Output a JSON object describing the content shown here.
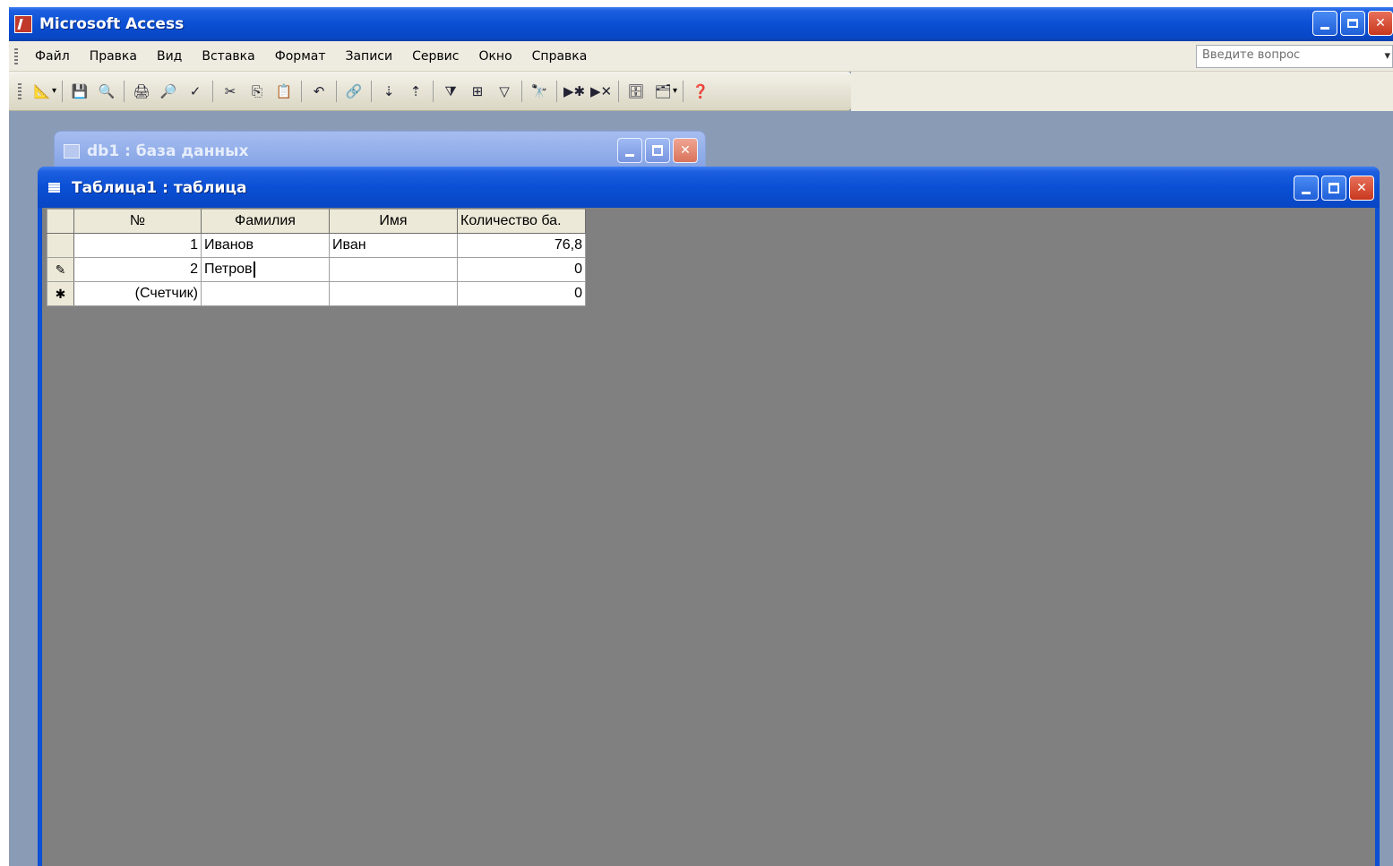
{
  "app": {
    "title": "Microsoft Access"
  },
  "menu": {
    "items": [
      "Файл",
      "Правка",
      "Вид",
      "Вставка",
      "Формат",
      "Записи",
      "Сервис",
      "Окно",
      "Справка"
    ],
    "ask_placeholder": "Введите вопрос"
  },
  "toolbar": {
    "icons": [
      "design-view-icon",
      "save-icon",
      "search-icon",
      "print-icon",
      "print-preview-icon",
      "spelling-icon",
      "cut-icon",
      "copy-icon",
      "paste-icon",
      "undo-icon",
      "hyperlink-icon",
      "sort-ascending-icon",
      "sort-descending-icon",
      "filter-by-selection-icon",
      "filter-by-form-icon",
      "apply-filter-icon",
      "find-icon",
      "new-record-icon",
      "delete-record-icon",
      "database-window-icon",
      "new-object-icon",
      "help-icon"
    ]
  },
  "db_window": {
    "title": "db1 : база данных"
  },
  "table_window": {
    "title": "Таблица1 : таблица",
    "columns": [
      "№",
      "Фамилия",
      "Имя",
      "Количество ба."
    ],
    "rows": [
      {
        "selector": "",
        "num": "1",
        "surname": "Иванов",
        "name": "Иван",
        "qty": "76,8"
      },
      {
        "selector": "✎",
        "num": "2",
        "surname": "Петров",
        "name": "",
        "qty": "0"
      },
      {
        "selector": "✱",
        "num": "(Счетчик)",
        "surname": "",
        "name": "",
        "qty": "0"
      }
    ]
  }
}
